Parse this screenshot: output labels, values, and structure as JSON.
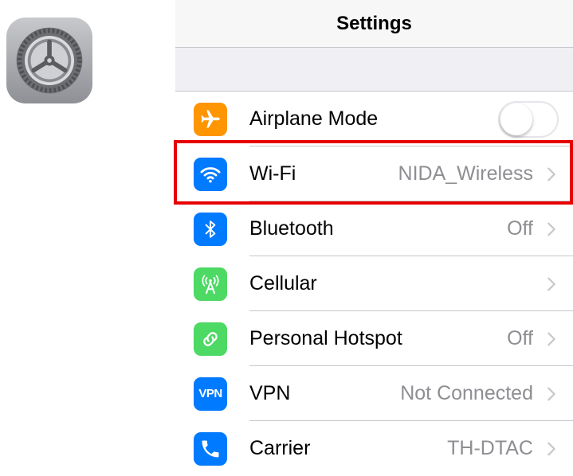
{
  "app_icon": {
    "icon": "settings-gear-icon"
  },
  "navbar": {
    "title": "Settings"
  },
  "rows": [
    {
      "label": "Airplane Mode",
      "detail": "",
      "icon": "airplane-icon",
      "color": "#ff9500",
      "control": "toggle",
      "toggle_on": false
    },
    {
      "label": "Wi-Fi",
      "detail": "NIDA_Wireless",
      "icon": "wifi-icon",
      "color": "#007aff",
      "control": "chevron"
    },
    {
      "label": "Bluetooth",
      "detail": "Off",
      "icon": "bluetooth-icon",
      "color": "#007aff",
      "control": "chevron"
    },
    {
      "label": "Cellular",
      "detail": "",
      "icon": "cellular-antenna-icon",
      "color": "#4cd964",
      "control": "chevron"
    },
    {
      "label": "Personal Hotspot",
      "detail": "Off",
      "icon": "hotspot-chain-icon",
      "color": "#4cd964",
      "control": "chevron"
    },
    {
      "label": "VPN",
      "detail": "Not Connected",
      "icon": "vpn-icon",
      "icon_text": "VPN",
      "color": "#007aff",
      "control": "chevron"
    },
    {
      "label": "Carrier",
      "detail": "TH-DTAC",
      "icon": "phone-icon",
      "color": "#007aff",
      "control": "chevron"
    }
  ],
  "highlight": {
    "target": "Wi-Fi",
    "color": "#e60000"
  }
}
